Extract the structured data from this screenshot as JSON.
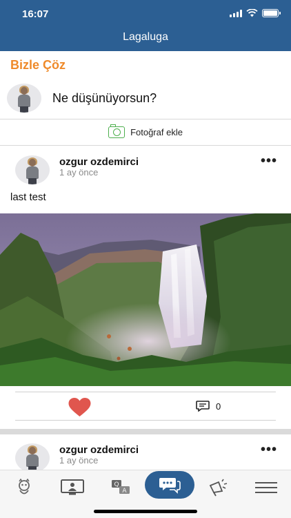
{
  "status_bar": {
    "time": "16:07"
  },
  "header": {
    "title": "Lagaluga"
  },
  "section": {
    "title": "Bizle Çöz"
  },
  "compose": {
    "prompt": "Ne düşünüyorsun?",
    "photo_label": "Fotoğraf ekle"
  },
  "posts": [
    {
      "author": "ozgur ozdemirci",
      "time": "1 ay önce",
      "text": "last test",
      "has_image": true,
      "comment_count": "0"
    },
    {
      "author": "ozgur ozdemirci",
      "time": "1 ay önce"
    }
  ],
  "tabbar": {
    "items": [
      {
        "icon": "mascot-icon",
        "active": false
      },
      {
        "icon": "video-presenter-icon",
        "active": false
      },
      {
        "icon": "question-answer-icon",
        "active": false
      },
      {
        "icon": "chat-bubbles-icon",
        "active": true
      },
      {
        "icon": "megaphone-icon",
        "active": false
      },
      {
        "icon": "hamburger-menu-icon",
        "active": false
      }
    ]
  },
  "colors": {
    "brand_blue": "#2c5f93",
    "section_orange": "#ef8a2a",
    "like_red": "#e0564e",
    "camera_green": "#4cae4c"
  }
}
